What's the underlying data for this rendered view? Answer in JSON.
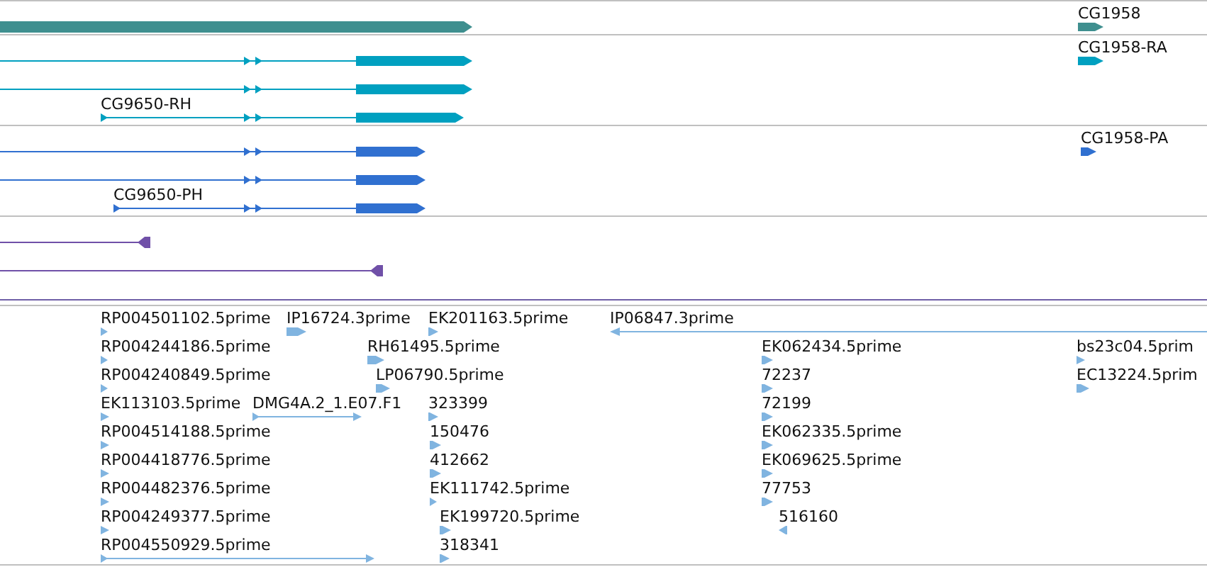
{
  "tracks": [
    {
      "kind": "gene",
      "color": "#3f8f8f",
      "features": [
        {
          "reverse": false
        },
        {
          "label": "CG1958",
          "reverse": false
        }
      ]
    },
    {
      "kind": "transcript",
      "color": "#00a0c0",
      "features": [
        {
          "reverse": false
        },
        {
          "reverse": false
        },
        {
          "label": "CG9650-RH",
          "reverse": false
        },
        {
          "label": "CG1958-RA",
          "reverse": false
        }
      ]
    },
    {
      "kind": "transcript",
      "color": "#3070d0",
      "features": [
        {
          "reverse": false
        },
        {
          "reverse": false
        },
        {
          "label": "CG9650-PH",
          "reverse": false
        },
        {
          "label": "CG1958-PA",
          "reverse": false
        }
      ]
    },
    {
      "kind": "read",
      "color": "#7050a8",
      "features": [
        {
          "reverse": true
        },
        {
          "reverse": true
        }
      ]
    },
    {
      "kind": "est",
      "color": "#80b4e0",
      "features": [
        {
          "label": "RP004501102.5prime",
          "reverse": false
        },
        {
          "label": "IP16724.3prime",
          "reverse": false
        },
        {
          "label": "EK201163.5prime",
          "reverse": false
        },
        {
          "label": "IP06847.3prime",
          "reverse": true
        },
        {
          "label": "RP004244186.5prime",
          "reverse": false
        },
        {
          "label": "RH61495.5prime",
          "reverse": false
        },
        {
          "label": "EK062434.5prime",
          "reverse": false
        },
        {
          "label": "bs23c04.5prim",
          "reverse": false
        },
        {
          "label": "RP004240849.5prime",
          "reverse": false
        },
        {
          "label": "LP06790.5prime",
          "reverse": false
        },
        {
          "label": "72237",
          "reverse": false
        },
        {
          "label": "EC13224.5prim",
          "reverse": false
        },
        {
          "label": "EK113103.5prime",
          "reverse": false
        },
        {
          "label": "DMG4A.2_1.E07.F1",
          "reverse": false
        },
        {
          "label": "323399",
          "reverse": false
        },
        {
          "label": "72199",
          "reverse": false
        },
        {
          "label": "RP004514188.5prime",
          "reverse": false
        },
        {
          "label": "150476",
          "reverse": false
        },
        {
          "label": "EK062335.5prime",
          "reverse": false
        },
        {
          "label": "RP004418776.5prime",
          "reverse": false
        },
        {
          "label": "412662",
          "reverse": false
        },
        {
          "label": "EK069625.5prime",
          "reverse": false
        },
        {
          "label": "RP004482376.5prime",
          "reverse": false
        },
        {
          "label": "EK111742.5prime",
          "reverse": false
        },
        {
          "label": "77753",
          "reverse": false
        },
        {
          "label": "RP004249377.5prime",
          "reverse": false
        },
        {
          "label": "EK199720.5prime",
          "reverse": false
        },
        {
          "label": "516160",
          "reverse": true
        },
        {
          "label": "RP004550929.5prime",
          "reverse": false
        },
        {
          "label": "318341",
          "reverse": false
        }
      ]
    }
  ]
}
